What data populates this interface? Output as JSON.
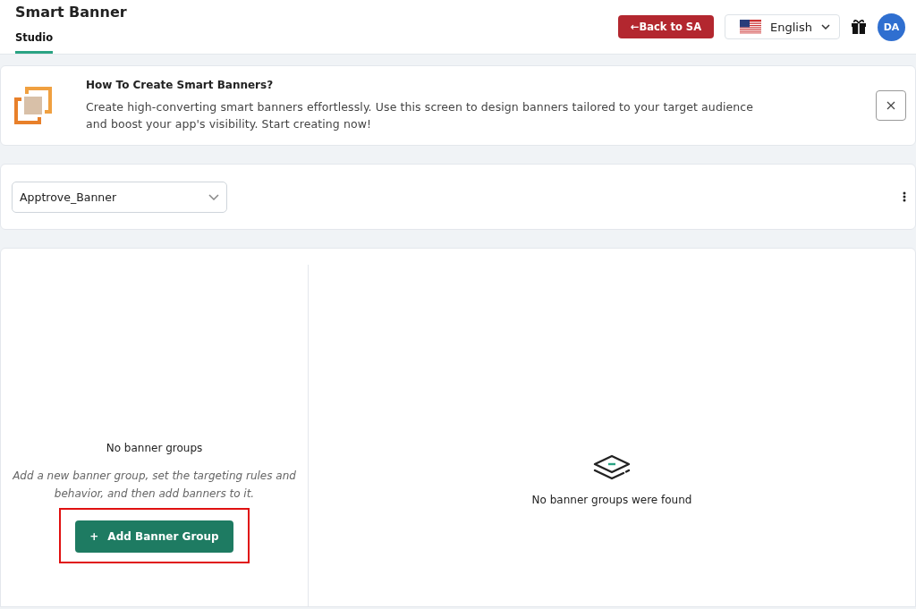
{
  "header": {
    "title": "Smart Banner",
    "tabs": [
      {
        "label": "Studio",
        "selected": true
      }
    ],
    "back_button": "←Back to SA",
    "language": "English",
    "avatar": "DA"
  },
  "info": {
    "title": "How To Create Smart Banners?",
    "text": "Create high-converting smart banners effortlessly. Use this screen to design banners tailored to your target audience and boost your app's visibility. Start creating now!"
  },
  "selector": {
    "value": "Apptrove_Banner"
  },
  "groups": {
    "empty_title": "No banner groups",
    "empty_text": "Add a new banner group, set the targeting rules and behavior, and then add banners to it.",
    "add_button": {
      "icon": "+",
      "label": "Add Banner Group",
      "highlighted": true
    },
    "detail_empty": "No banner groups were found"
  }
}
